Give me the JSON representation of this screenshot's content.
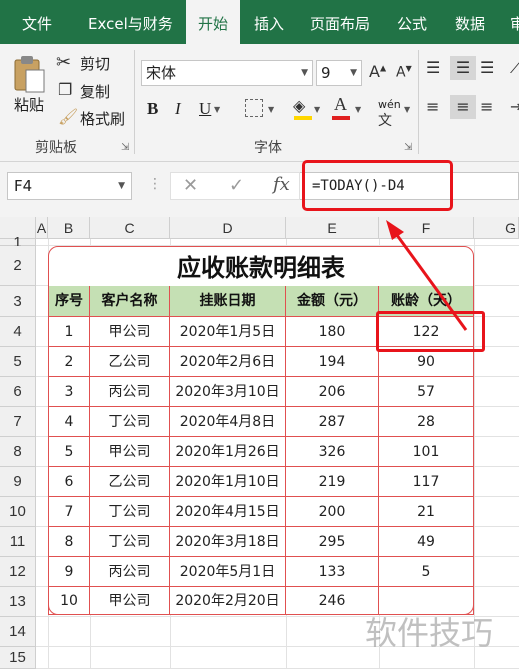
{
  "ribbon_tabs": [
    "文件",
    "Excel与财务",
    "开始",
    "插入",
    "页面布局",
    "公式",
    "数据",
    "审"
  ],
  "active_tab": "开始",
  "clipboard": {
    "paste": "粘贴",
    "cut": "剪切",
    "copy": "复制",
    "format_painter": "格式刷",
    "group_label": "剪贴板"
  },
  "font": {
    "font_name": "宋体",
    "font_size": "9",
    "group_label": "字体",
    "bold": "B",
    "italic": "I",
    "underline": "U",
    "phonetic": "wén"
  },
  "name_box": "F4",
  "formula": "=TODAY()-D4",
  "columns": [
    "A",
    "B",
    "C",
    "D",
    "E",
    "F",
    "G"
  ],
  "rows": [
    "1",
    "2",
    "3",
    "4",
    "5",
    "6",
    "7",
    "8",
    "9",
    "10",
    "11",
    "12",
    "13",
    "14",
    "15"
  ],
  "sheet": {
    "title": "应收账款明细表",
    "headers": [
      "序号",
      "客户名称",
      "挂账日期",
      "金额（元）",
      "账龄（天）"
    ],
    "data": [
      [
        "1",
        "甲公司",
        "2020年1月5日",
        "180",
        "122"
      ],
      [
        "2",
        "乙公司",
        "2020年2月6日",
        "194",
        "90"
      ],
      [
        "3",
        "丙公司",
        "2020年3月10日",
        "206",
        "57"
      ],
      [
        "4",
        "丁公司",
        "2020年4月8日",
        "287",
        "28"
      ],
      [
        "5",
        "甲公司",
        "2020年1月26日",
        "326",
        "101"
      ],
      [
        "6",
        "乙公司",
        "2020年1月10日",
        "219",
        "117"
      ],
      [
        "7",
        "丁公司",
        "2020年4月15日",
        "200",
        "21"
      ],
      [
        "8",
        "丁公司",
        "2020年3月18日",
        "295",
        "49"
      ],
      [
        "9",
        "丙公司",
        "2020年5月1日",
        "133",
        "5"
      ],
      [
        "10",
        "甲公司",
        "2020年2月20日",
        "246",
        ""
      ]
    ]
  },
  "watermark": "软件技巧",
  "colors": {
    "ribbon_green": "#217346",
    "table_border": "#e05050",
    "header_fill": "#c5e0b4",
    "highlight": "#e8141b"
  }
}
